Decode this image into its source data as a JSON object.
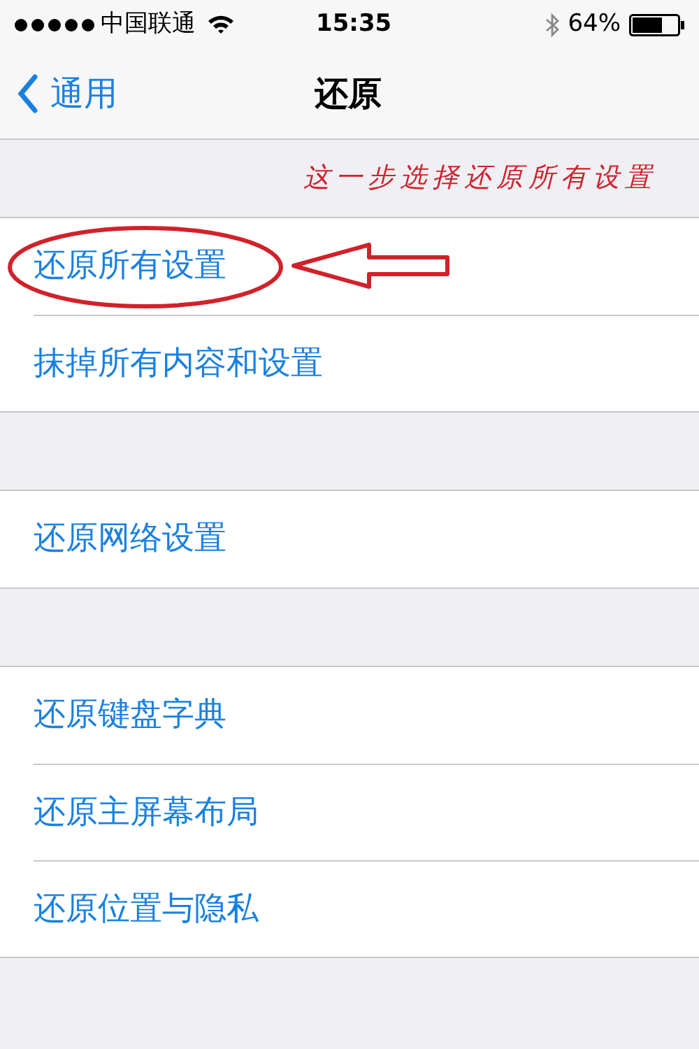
{
  "status_bar": {
    "carrier": "中国联通",
    "time": "15:35",
    "battery": "64%"
  },
  "nav": {
    "back": "通用",
    "title": "还原"
  },
  "annotation": "这一步选择还原所有设置",
  "groups": [
    {
      "items": [
        {
          "label": "还原所有设置",
          "circled": true
        },
        {
          "label": "抹掉所有内容和设置",
          "circled": false
        }
      ]
    },
    {
      "items": [
        {
          "label": "还原网络设置",
          "circled": false
        }
      ]
    },
    {
      "items": [
        {
          "label": "还原键盘字典",
          "circled": false
        },
        {
          "label": "还原主屏幕布局",
          "circled": false
        },
        {
          "label": "还原位置与隐私",
          "circled": false
        }
      ]
    }
  ]
}
